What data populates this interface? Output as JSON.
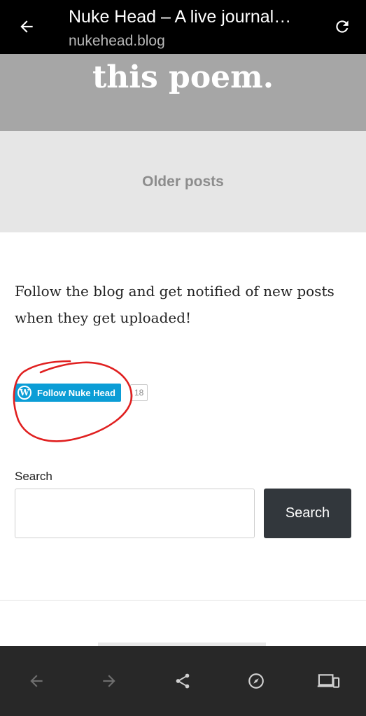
{
  "browser": {
    "title": "Nuke Head – A live journal…",
    "url": "nukehead.blog"
  },
  "hero": {
    "poem_text": "this poem."
  },
  "pagination": {
    "older_posts": "Older posts"
  },
  "follow": {
    "text": "Follow the blog and get notified of new posts when they get uploaded!",
    "button_label": "Follow Nuke Head",
    "count": "18"
  },
  "search": {
    "label": "Search",
    "placeholder": "",
    "button_label": "Search"
  },
  "nav": {
    "icons": [
      "back-arrow-icon",
      "forward-arrow-icon",
      "share-icon",
      "compass-icon",
      "devices-icon"
    ]
  },
  "colors": {
    "follow_button": "#0b9dd6",
    "search_button": "#32373c",
    "annotation": "#e02020"
  }
}
